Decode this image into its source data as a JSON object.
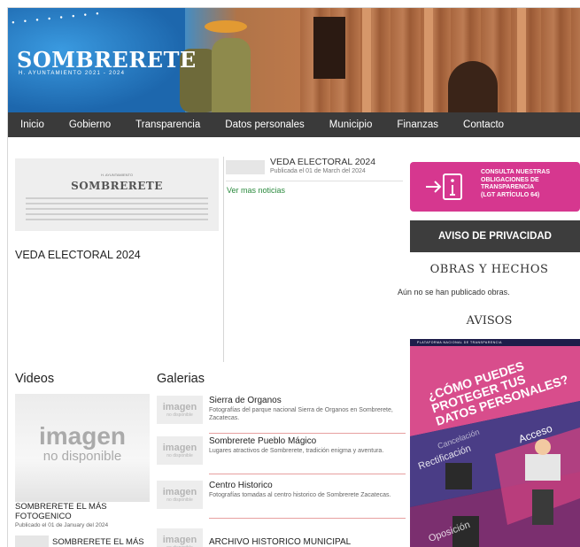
{
  "banner": {
    "logo": "SOMBRERETE",
    "subtitle": "H. AYUNTAMIENTO 2021 - 2024"
  },
  "nav": {
    "items": [
      "Inicio",
      "Gobierno",
      "Transparencia",
      "Datos personales",
      "Municipio",
      "Finanzas",
      "Contacto"
    ]
  },
  "featured": {
    "image_heading": "SOMBRERETE",
    "image_small": "H. AYUNTAMIENTO",
    "title": "VEDA ELECTORAL 2024"
  },
  "news": {
    "items": [
      {
        "title": "VEDA ELECTORAL 2024",
        "date": "Publicada el 01 de March del 2024"
      }
    ],
    "more_label": "Ver mas noticias"
  },
  "sidebar": {
    "transparency_text": "CONSULTA NUESTRAS\nOBLIGACIONES DE\nTRANSPARENCIA\n(LGT ARTÍCULO 64)",
    "privacy_button": "AVISO DE PRIVACIDAD",
    "obras_title": "OBRAS Y HECHOS",
    "obras_empty": "Aún no se han publicado obras.",
    "avisos_title": "AVISOS",
    "poster_header": "PLATAFORMA NACIONAL DE TRANSPARENCIA",
    "poster_headline": "¿CÓMO PUEDES PROTEGER TUS DATOS PERSONALES?",
    "poster_words": [
      "Acceso",
      "Rectificación",
      "Cancelación",
      "Oposición"
    ]
  },
  "videos": {
    "heading": "Videos",
    "placeholder_big": "imagen",
    "placeholder_small": "no disponible",
    "items": [
      {
        "title": "SOMBRERETE EL MÁS FOTOGENICO",
        "date": "Publicado el 01 de January del 2024"
      },
      {
        "title": "SOMBRERETE EL MÁS"
      }
    ]
  },
  "galerias": {
    "heading": "Galerias",
    "thumb_big": "imagen",
    "thumb_small": "no disponible",
    "items": [
      {
        "title": "Sierra de Organos",
        "desc": "Fotografías del parque nacional Sierra de Organos en Sombrerete, Zacatecas."
      },
      {
        "title": "Sombrerete Pueblo Mágico",
        "desc": "Lugares atractivos de Sombrerete, tradición enigma y aventura."
      },
      {
        "title": "Centro Historico",
        "desc": "Fotografías tomadas al centro historico de Sombrerete Zacatecas."
      },
      {
        "title": "ARCHIVO HISTORICO MUNICIPAL",
        "desc": ""
      }
    ]
  },
  "colors": {
    "nav_bg": "#3a3a3a",
    "transparency_pink": "#d6378f",
    "privacy_bg": "#3d3d3d",
    "link_green": "#2b8a3e"
  },
  "icons": [
    "transparency-info-icon"
  ]
}
